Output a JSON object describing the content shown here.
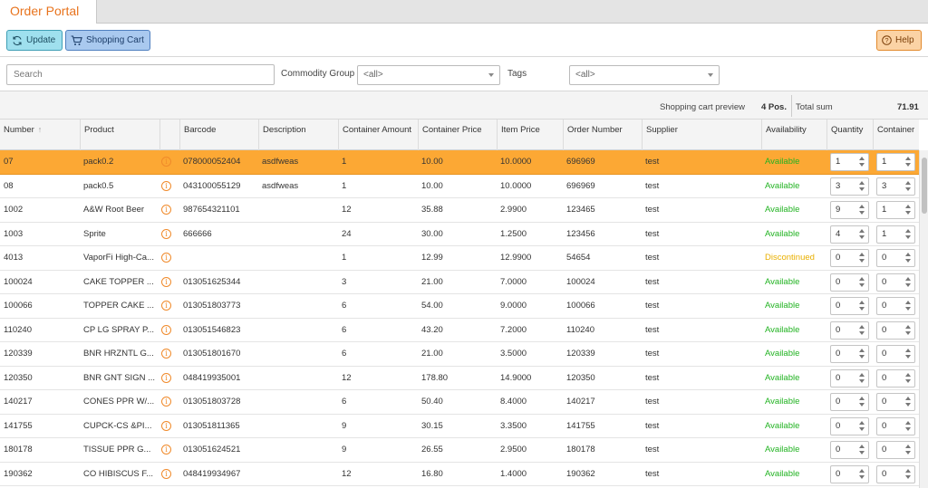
{
  "app": {
    "tab_title": "Order Portal"
  },
  "toolbar": {
    "update_label": "Update",
    "cart_label": "Shopping Cart",
    "help_label": "Help"
  },
  "filters": {
    "search_placeholder": "Search",
    "commodity_label": "Commodity Group",
    "commodity_value": "<all>",
    "tags_label": "Tags",
    "tags_value": "<all>"
  },
  "summary": {
    "preview_label": "Shopping cart preview",
    "positions": "4 Pos.",
    "total_label": "Total sum",
    "total_value": "71.91"
  },
  "columns": [
    "Number",
    "Product",
    "",
    "Barcode",
    "Description",
    "Container Amount",
    "Container Price",
    "Item Price",
    "Order Number",
    "Supplier",
    "Availability",
    "Quantity",
    "Container"
  ],
  "rows": [
    {
      "number": "07",
      "product": "pack0.2",
      "barcode": "078000052404",
      "description": "asdfweas",
      "container_amount": "1",
      "container_price": "10.00",
      "item_price": "10.0000",
      "order_number": "696969",
      "supplier": "test",
      "availability": "Available",
      "quantity": "1",
      "container": "1",
      "selected": true
    },
    {
      "number": "08",
      "product": "pack0.5",
      "barcode": "043100055129",
      "description": "asdfweas",
      "container_amount": "1",
      "container_price": "10.00",
      "item_price": "10.0000",
      "order_number": "696969",
      "supplier": "test",
      "availability": "Available",
      "quantity": "3",
      "container": "3"
    },
    {
      "number": "1002",
      "product": "A&W Root Beer",
      "barcode": "987654321101",
      "description": "",
      "container_amount": "12",
      "container_price": "35.88",
      "item_price": "2.9900",
      "order_number": "123465",
      "supplier": "test",
      "availability": "Available",
      "quantity": "9",
      "container": "1"
    },
    {
      "number": "1003",
      "product": "Sprite",
      "barcode": "666666",
      "description": "",
      "container_amount": "24",
      "container_price": "30.00",
      "item_price": "1.2500",
      "order_number": "123456",
      "supplier": "test",
      "availability": "Available",
      "quantity": "4",
      "container": "1"
    },
    {
      "number": "4013",
      "product": "VaporFi High-Ca...",
      "barcode": "",
      "description": "",
      "container_amount": "1",
      "container_price": "12.99",
      "item_price": "12.9900",
      "order_number": "54654",
      "supplier": "test",
      "availability": "Discontinued",
      "quantity": "0",
      "container": "0"
    },
    {
      "number": "100024",
      "product": "CAKE TOPPER ...",
      "barcode": "013051625344",
      "description": "",
      "container_amount": "3",
      "container_price": "21.00",
      "item_price": "7.0000",
      "order_number": "100024",
      "supplier": "test",
      "availability": "Available",
      "quantity": "0",
      "container": "0"
    },
    {
      "number": "100066",
      "product": "TOPPER CAKE ...",
      "barcode": "013051803773",
      "description": "",
      "container_amount": "6",
      "container_price": "54.00",
      "item_price": "9.0000",
      "order_number": "100066",
      "supplier": "test",
      "availability": "Available",
      "quantity": "0",
      "container": "0"
    },
    {
      "number": "110240",
      "product": "CP LG SPRAY P...",
      "barcode": "013051546823",
      "description": "",
      "container_amount": "6",
      "container_price": "43.20",
      "item_price": "7.2000",
      "order_number": "110240",
      "supplier": "test",
      "availability": "Available",
      "quantity": "0",
      "container": "0"
    },
    {
      "number": "120339",
      "product": "BNR HRZNTL G...",
      "barcode": "013051801670",
      "description": "",
      "container_amount": "6",
      "container_price": "21.00",
      "item_price": "3.5000",
      "order_number": "120339",
      "supplier": "test",
      "availability": "Available",
      "quantity": "0",
      "container": "0"
    },
    {
      "number": "120350",
      "product": "BNR GNT SIGN ...",
      "barcode": "048419935001",
      "description": "",
      "container_amount": "12",
      "container_price": "178.80",
      "item_price": "14.9000",
      "order_number": "120350",
      "supplier": "test",
      "availability": "Available",
      "quantity": "0",
      "container": "0"
    },
    {
      "number": "140217",
      "product": "CONES PPR W/...",
      "barcode": "013051803728",
      "description": "",
      "container_amount": "6",
      "container_price": "50.40",
      "item_price": "8.4000",
      "order_number": "140217",
      "supplier": "test",
      "availability": "Available",
      "quantity": "0",
      "container": "0"
    },
    {
      "number": "141755",
      "product": "CUPCK-CS &PI...",
      "barcode": "013051811365",
      "description": "",
      "container_amount": "9",
      "container_price": "30.15",
      "item_price": "3.3500",
      "order_number": "141755",
      "supplier": "test",
      "availability": "Available",
      "quantity": "0",
      "container": "0"
    },
    {
      "number": "180178",
      "product": "TISSUE PPR G...",
      "barcode": "013051624521",
      "description": "",
      "container_amount": "9",
      "container_price": "26.55",
      "item_price": "2.9500",
      "order_number": "180178",
      "supplier": "test",
      "availability": "Available",
      "quantity": "0",
      "container": "0"
    },
    {
      "number": "190362",
      "product": "CO HIBISCUS F...",
      "barcode": "048419934967",
      "description": "",
      "container_amount": "12",
      "container_price": "16.80",
      "item_price": "1.4000",
      "order_number": "190362",
      "supplier": "test",
      "availability": "Available",
      "quantity": "0",
      "container": "0"
    }
  ],
  "colors": {
    "accent": "#e8731d",
    "selected_row": "#fca834",
    "available": "#22b322",
    "discontinued": "#e9b000"
  }
}
